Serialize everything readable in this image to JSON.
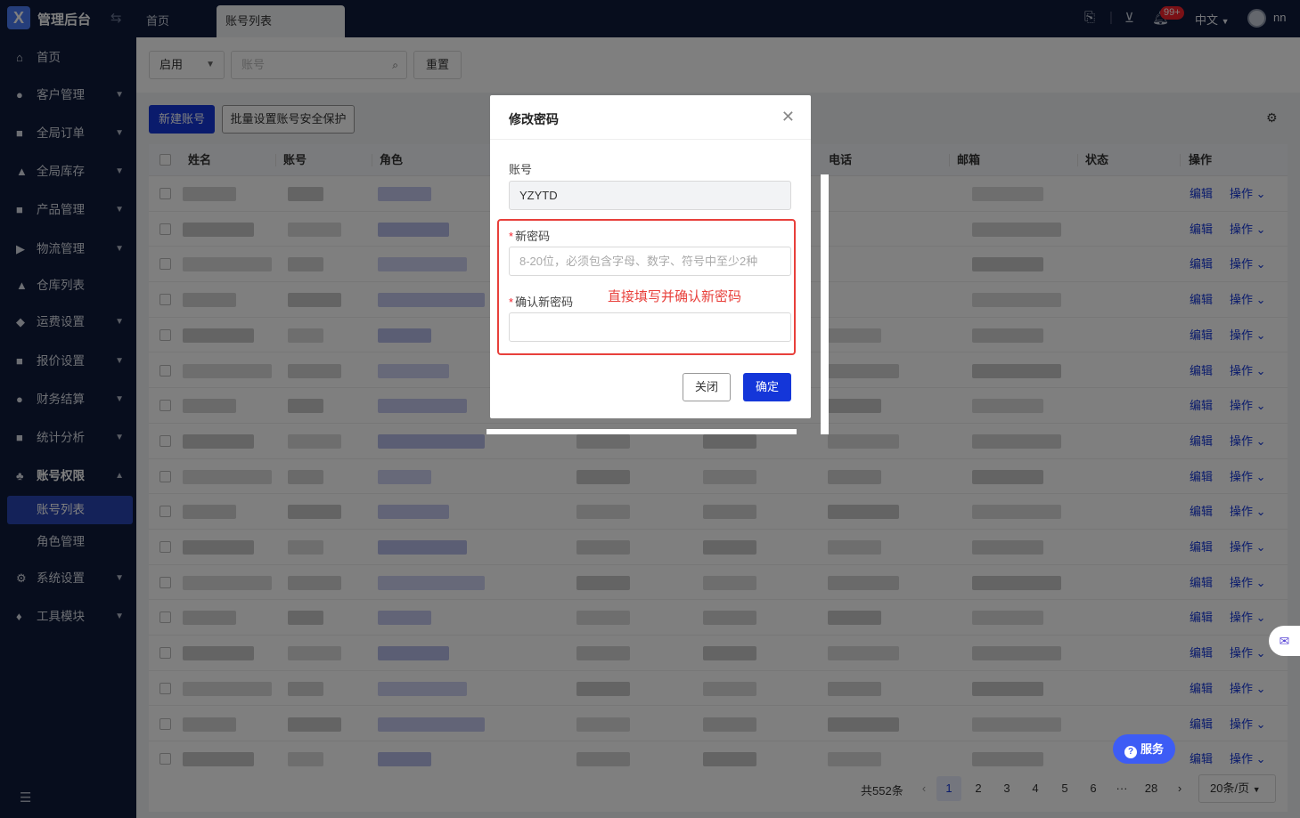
{
  "topbar": {
    "brand": "管理后台",
    "tabs": [
      "首页",
      "账号列表"
    ],
    "notification_badge": "99+",
    "language": "中文",
    "username": "nn"
  },
  "sidebar": {
    "items": [
      {
        "label": "首页",
        "icon": "home-icon"
      },
      {
        "label": "客户管理",
        "icon": "users-icon"
      },
      {
        "label": "全局订单",
        "icon": "order-icon"
      },
      {
        "label": "全局库存",
        "icon": "warehouse-icon"
      },
      {
        "label": "产品管理",
        "icon": "product-icon"
      },
      {
        "label": "物流管理",
        "icon": "truck-icon"
      },
      {
        "label": "仓库列表",
        "icon": "store-icon"
      },
      {
        "label": "运费设置",
        "icon": "freight-icon"
      },
      {
        "label": "报价设置",
        "icon": "quote-icon"
      },
      {
        "label": "财务结算",
        "icon": "finance-icon"
      },
      {
        "label": "统计分析",
        "icon": "chart-icon"
      },
      {
        "label": "账号权限",
        "icon": "org-icon"
      },
      {
        "label": "账号列表"
      },
      {
        "label": "角色管理"
      },
      {
        "label": "系统设置",
        "icon": "gear-icon"
      },
      {
        "label": "工具模块",
        "icon": "tool-icon"
      }
    ]
  },
  "filter": {
    "status_value": "启用",
    "account_placeholder": "账号",
    "reset_label": "重置"
  },
  "toolbar": {
    "new_label": "新建账号",
    "batch_label": "批量设置账号安全保护"
  },
  "table": {
    "columns": [
      "姓名",
      "账号",
      "角色",
      "电话",
      "邮箱",
      "状态",
      "操作"
    ],
    "edit_label": "编辑",
    "op_label": "操作"
  },
  "pagination": {
    "total": "共552条",
    "pages": [
      "1",
      "2",
      "3",
      "4",
      "5",
      "6",
      "···",
      "28"
    ],
    "page_size": "20条/页"
  },
  "modal": {
    "title": "修改密码",
    "account_label": "账号",
    "account_value": "YZYTD",
    "new_password_label": "新密码",
    "new_password_placeholder": "8-20位，必须包含字母、数字、符号中至少2种",
    "confirm_password_label": "确认新密码",
    "annotation": "直接填写并确认新密码",
    "close_label": "关闭",
    "ok_label": "确定"
  },
  "floating": {
    "service_label": "服务"
  },
  "colors": {
    "primary": "#1436d9",
    "sidebar_bg": "#0e1a3a",
    "annotation": "#e8403b"
  }
}
